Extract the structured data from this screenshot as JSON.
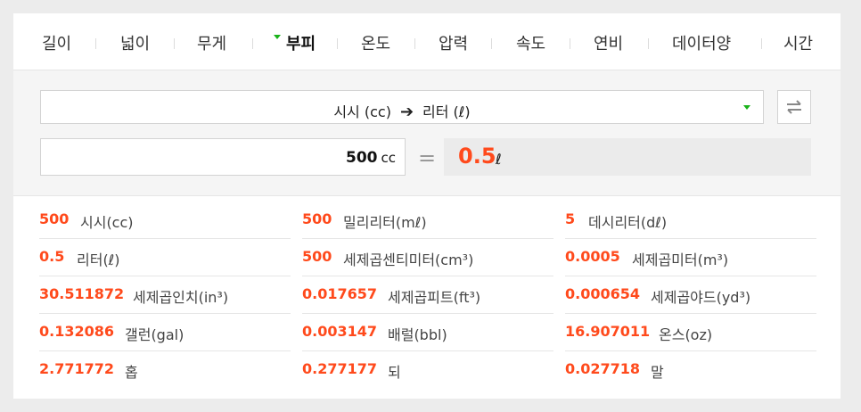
{
  "tabs": [
    "길이",
    "넓이",
    "무게",
    "부피",
    "온도",
    "압력",
    "속도",
    "연비",
    "데이터양",
    "시간"
  ],
  "active_tab": "부피",
  "selector": {
    "from": "시시 (cc)",
    "to": "리터 (ℓ)"
  },
  "input": {
    "value": "500",
    "unit": "cc"
  },
  "equals": "=",
  "result": {
    "value": "0.5",
    "unit": "ℓ"
  },
  "colors": {
    "accent": "#ff4a1c",
    "caret": "#19b219"
  },
  "conversions": [
    {
      "value": "500",
      "name": "시시(cc)"
    },
    {
      "value": "500",
      "name": "밀리리터(mℓ)"
    },
    {
      "value": "5",
      "name": "데시리터(dℓ)"
    },
    {
      "value": "0.5",
      "name": "리터(ℓ)"
    },
    {
      "value": "500",
      "name": "세제곱센티미터(cm³)"
    },
    {
      "value": "0.0005",
      "name": "세제곱미터(m³)"
    },
    {
      "value": "30.511872",
      "name": "세제곱인치(in³)"
    },
    {
      "value": "0.017657",
      "name": "세제곱피트(ft³)"
    },
    {
      "value": "0.000654",
      "name": "세제곱야드(yd³)"
    },
    {
      "value": "0.132086",
      "name": "갤런(gal)"
    },
    {
      "value": "0.003147",
      "name": "배럴(bbl)"
    },
    {
      "value": "16.907011",
      "name": "온스(oz)"
    },
    {
      "value": "2.771772",
      "name": "홉"
    },
    {
      "value": "0.277177",
      "name": "되"
    },
    {
      "value": "0.027718",
      "name": "말"
    }
  ]
}
